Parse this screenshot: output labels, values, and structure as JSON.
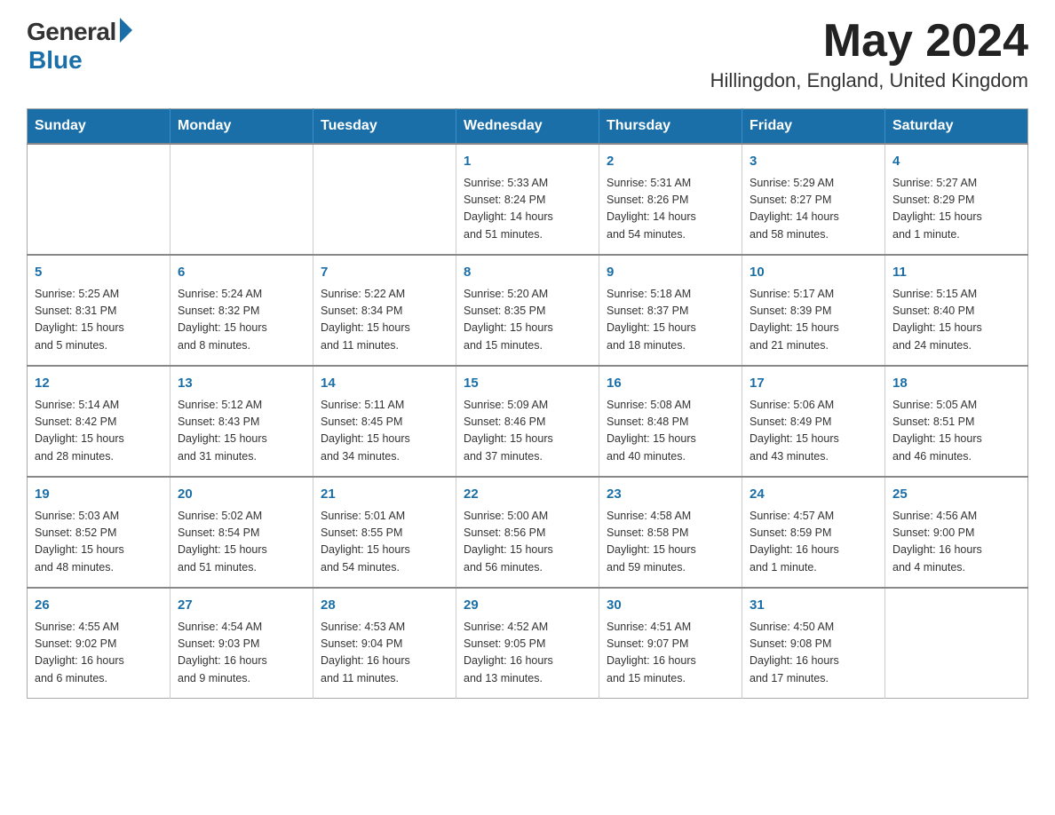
{
  "logo": {
    "general": "General",
    "blue": "Blue"
  },
  "title": {
    "month_year": "May 2024",
    "location": "Hillingdon, England, United Kingdom"
  },
  "header_days": [
    "Sunday",
    "Monday",
    "Tuesday",
    "Wednesday",
    "Thursday",
    "Friday",
    "Saturday"
  ],
  "weeks": [
    [
      {
        "day": "",
        "info": ""
      },
      {
        "day": "",
        "info": ""
      },
      {
        "day": "",
        "info": ""
      },
      {
        "day": "1",
        "info": "Sunrise: 5:33 AM\nSunset: 8:24 PM\nDaylight: 14 hours\nand 51 minutes."
      },
      {
        "day": "2",
        "info": "Sunrise: 5:31 AM\nSunset: 8:26 PM\nDaylight: 14 hours\nand 54 minutes."
      },
      {
        "day": "3",
        "info": "Sunrise: 5:29 AM\nSunset: 8:27 PM\nDaylight: 14 hours\nand 58 minutes."
      },
      {
        "day": "4",
        "info": "Sunrise: 5:27 AM\nSunset: 8:29 PM\nDaylight: 15 hours\nand 1 minute."
      }
    ],
    [
      {
        "day": "5",
        "info": "Sunrise: 5:25 AM\nSunset: 8:31 PM\nDaylight: 15 hours\nand 5 minutes."
      },
      {
        "day": "6",
        "info": "Sunrise: 5:24 AM\nSunset: 8:32 PM\nDaylight: 15 hours\nand 8 minutes."
      },
      {
        "day": "7",
        "info": "Sunrise: 5:22 AM\nSunset: 8:34 PM\nDaylight: 15 hours\nand 11 minutes."
      },
      {
        "day": "8",
        "info": "Sunrise: 5:20 AM\nSunset: 8:35 PM\nDaylight: 15 hours\nand 15 minutes."
      },
      {
        "day": "9",
        "info": "Sunrise: 5:18 AM\nSunset: 8:37 PM\nDaylight: 15 hours\nand 18 minutes."
      },
      {
        "day": "10",
        "info": "Sunrise: 5:17 AM\nSunset: 8:39 PM\nDaylight: 15 hours\nand 21 minutes."
      },
      {
        "day": "11",
        "info": "Sunrise: 5:15 AM\nSunset: 8:40 PM\nDaylight: 15 hours\nand 24 minutes."
      }
    ],
    [
      {
        "day": "12",
        "info": "Sunrise: 5:14 AM\nSunset: 8:42 PM\nDaylight: 15 hours\nand 28 minutes."
      },
      {
        "day": "13",
        "info": "Sunrise: 5:12 AM\nSunset: 8:43 PM\nDaylight: 15 hours\nand 31 minutes."
      },
      {
        "day": "14",
        "info": "Sunrise: 5:11 AM\nSunset: 8:45 PM\nDaylight: 15 hours\nand 34 minutes."
      },
      {
        "day": "15",
        "info": "Sunrise: 5:09 AM\nSunset: 8:46 PM\nDaylight: 15 hours\nand 37 minutes."
      },
      {
        "day": "16",
        "info": "Sunrise: 5:08 AM\nSunset: 8:48 PM\nDaylight: 15 hours\nand 40 minutes."
      },
      {
        "day": "17",
        "info": "Sunrise: 5:06 AM\nSunset: 8:49 PM\nDaylight: 15 hours\nand 43 minutes."
      },
      {
        "day": "18",
        "info": "Sunrise: 5:05 AM\nSunset: 8:51 PM\nDaylight: 15 hours\nand 46 minutes."
      }
    ],
    [
      {
        "day": "19",
        "info": "Sunrise: 5:03 AM\nSunset: 8:52 PM\nDaylight: 15 hours\nand 48 minutes."
      },
      {
        "day": "20",
        "info": "Sunrise: 5:02 AM\nSunset: 8:54 PM\nDaylight: 15 hours\nand 51 minutes."
      },
      {
        "day": "21",
        "info": "Sunrise: 5:01 AM\nSunset: 8:55 PM\nDaylight: 15 hours\nand 54 minutes."
      },
      {
        "day": "22",
        "info": "Sunrise: 5:00 AM\nSunset: 8:56 PM\nDaylight: 15 hours\nand 56 minutes."
      },
      {
        "day": "23",
        "info": "Sunrise: 4:58 AM\nSunset: 8:58 PM\nDaylight: 15 hours\nand 59 minutes."
      },
      {
        "day": "24",
        "info": "Sunrise: 4:57 AM\nSunset: 8:59 PM\nDaylight: 16 hours\nand 1 minute."
      },
      {
        "day": "25",
        "info": "Sunrise: 4:56 AM\nSunset: 9:00 PM\nDaylight: 16 hours\nand 4 minutes."
      }
    ],
    [
      {
        "day": "26",
        "info": "Sunrise: 4:55 AM\nSunset: 9:02 PM\nDaylight: 16 hours\nand 6 minutes."
      },
      {
        "day": "27",
        "info": "Sunrise: 4:54 AM\nSunset: 9:03 PM\nDaylight: 16 hours\nand 9 minutes."
      },
      {
        "day": "28",
        "info": "Sunrise: 4:53 AM\nSunset: 9:04 PM\nDaylight: 16 hours\nand 11 minutes."
      },
      {
        "day": "29",
        "info": "Sunrise: 4:52 AM\nSunset: 9:05 PM\nDaylight: 16 hours\nand 13 minutes."
      },
      {
        "day": "30",
        "info": "Sunrise: 4:51 AM\nSunset: 9:07 PM\nDaylight: 16 hours\nand 15 minutes."
      },
      {
        "day": "31",
        "info": "Sunrise: 4:50 AM\nSunset: 9:08 PM\nDaylight: 16 hours\nand 17 minutes."
      },
      {
        "day": "",
        "info": ""
      }
    ]
  ]
}
